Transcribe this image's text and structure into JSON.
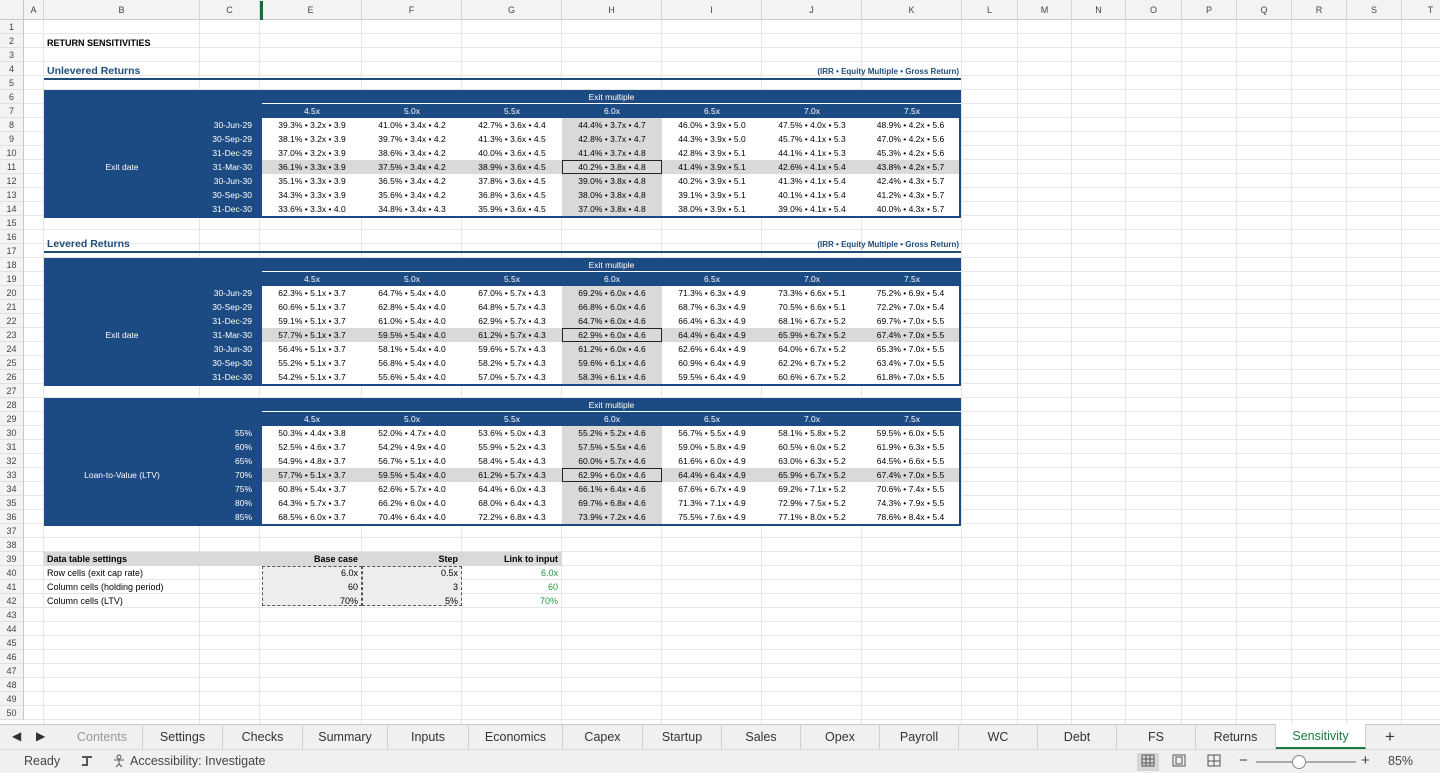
{
  "columns": [
    "A",
    "B",
    "C",
    "E",
    "F",
    "G",
    "H",
    "I",
    "J",
    "K",
    "L",
    "M",
    "N",
    "O",
    "P",
    "Q",
    "R",
    "S",
    "T"
  ],
  "sheet_title": "RETURN SENSITIVITIES",
  "unlevered": {
    "title": "Unlevered Returns",
    "note": "(IRR • Equity Multiple • Gross Return)",
    "header": "Exit multiple",
    "row_label": "Exit date",
    "col_labels": [
      "4.5x",
      "5.0x",
      "5.5x",
      "6.0x",
      "6.5x",
      "7.0x",
      "7.5x"
    ],
    "row_labels": [
      "30-Jun-29",
      "30-Sep-29",
      "31-Dec-29",
      "31-Mar-30",
      "30-Jun-30",
      "30-Sep-30",
      "31-Dec-30"
    ],
    "rows": [
      [
        "39.3% • 3.2x • 3.9",
        "41.0% • 3.4x • 4.2",
        "42.7% • 3.6x • 4.4",
        "44.4% • 3.7x • 4.7",
        "46.0% • 3.9x • 5.0",
        "47.5% • 4.0x • 5.3",
        "48.9% • 4.2x • 5.6"
      ],
      [
        "38.1% • 3.2x • 3.9",
        "39.7% • 3.4x • 4.2",
        "41.3% • 3.6x • 4.5",
        "42.8% • 3.7x • 4.7",
        "44.3% • 3.9x • 5.0",
        "45.7% • 4.1x • 5.3",
        "47.0% • 4.2x • 5.6"
      ],
      [
        "37.0% • 3.2x • 3.9",
        "38.6% • 3.4x • 4.2",
        "40.0% • 3.6x • 4.5",
        "41.4% • 3.7x • 4.8",
        "42.8% • 3.9x • 5.1",
        "44.1% • 4.1x • 5.3",
        "45.3% • 4.2x • 5.6"
      ],
      [
        "36.1% • 3.3x • 3.9",
        "37.5% • 3.4x • 4.2",
        "38.9% • 3.6x • 4.5",
        "40.2% • 3.8x • 4.8",
        "41.4% • 3.9x • 5.1",
        "42.6% • 4.1x • 5.4",
        "43.8% • 4.2x • 5.7"
      ],
      [
        "35.1% • 3.3x • 3.9",
        "36.5% • 3.4x • 4.2",
        "37.8% • 3.6x • 4.5",
        "39.0% • 3.8x • 4.8",
        "40.2% • 3.9x • 5.1",
        "41.3% • 4.1x • 5.4",
        "42.4% • 4.3x • 5.7"
      ],
      [
        "34.3% • 3.3x • 3.9",
        "35.6% • 3.4x • 4.2",
        "36.8% • 3.6x • 4.5",
        "38.0% • 3.8x • 4.8",
        "39.1% • 3.9x • 5.1",
        "40.1% • 4.1x • 5.4",
        "41.2% • 4.3x • 5.7"
      ],
      [
        "33.6% • 3.3x • 4.0",
        "34.8% • 3.4x • 4.3",
        "35.9% • 3.6x • 4.5",
        "37.0% • 3.8x • 4.8",
        "38.0% • 3.9x • 5.1",
        "39.0% • 4.1x • 5.4",
        "40.0% • 4.3x • 5.7"
      ]
    ]
  },
  "levered": {
    "title": "Levered Returns",
    "note": "(IRR • Equity Multiple • Gross Return)",
    "header": "Exit multiple",
    "row_label": "Exit date",
    "col_labels": [
      "4.5x",
      "5.0x",
      "5.5x",
      "6.0x",
      "6.5x",
      "7.0x",
      "7.5x"
    ],
    "row_labels": [
      "30-Jun-29",
      "30-Sep-29",
      "31-Dec-29",
      "31-Mar-30",
      "30-Jun-30",
      "30-Sep-30",
      "31-Dec-30"
    ],
    "rows": [
      [
        "62.3% • 5.1x • 3.7",
        "64.7% • 5.4x • 4.0",
        "67.0% • 5.7x • 4.3",
        "69.2% • 6.0x • 4.6",
        "71.3% • 6.3x • 4.9",
        "73.3% • 6.6x • 5.1",
        "75.2% • 6.9x • 5.4"
      ],
      [
        "60.6% • 5.1x • 3.7",
        "62.8% • 5.4x • 4.0",
        "64.8% • 5.7x • 4.3",
        "66.8% • 6.0x • 4.6",
        "68.7% • 6.3x • 4.9",
        "70.5% • 6.6x • 5.1",
        "72.2% • 7.0x • 5.4"
      ],
      [
        "59.1% • 5.1x • 3.7",
        "61.0% • 5.4x • 4.0",
        "62.9% • 5.7x • 4.3",
        "64.7% • 6.0x • 4.6",
        "66.4% • 6.3x • 4.9",
        "68.1% • 6.7x • 5.2",
        "69.7% • 7.0x • 5.5"
      ],
      [
        "57.7% • 5.1x • 3.7",
        "59.5% • 5.4x • 4.0",
        "61.2% • 5.7x • 4.3",
        "62.9% • 6.0x • 4.6",
        "64.4% • 6.4x • 4.9",
        "65.9% • 6.7x • 5.2",
        "67.4% • 7.0x • 5.5"
      ],
      [
        "56.4% • 5.1x • 3.7",
        "58.1% • 5.4x • 4.0",
        "59.6% • 5.7x • 4.3",
        "61.2% • 6.0x • 4.6",
        "62.6% • 6.4x • 4.9",
        "64.0% • 6.7x • 5.2",
        "65.3% • 7.0x • 5.5"
      ],
      [
        "55.2% • 5.1x • 3.7",
        "56.8% • 5.4x • 4.0",
        "58.2% • 5.7x • 4.3",
        "59.6% • 6.1x • 4.6",
        "60.9% • 6.4x • 4.9",
        "62.2% • 6.7x • 5.2",
        "63.4% • 7.0x • 5.5"
      ],
      [
        "54.2% • 5.1x • 3.7",
        "55.6% • 5.4x • 4.0",
        "57.0% • 5.7x • 4.3",
        "58.3% • 6.1x • 4.6",
        "59.5% • 6.4x • 4.9",
        "60.6% • 6.7x • 5.2",
        "61.8% • 7.0x • 5.5"
      ]
    ]
  },
  "ltv": {
    "header": "Exit multiple",
    "row_label": "Loan-to-Value (LTV)",
    "col_labels": [
      "4.5x",
      "5.0x",
      "5.5x",
      "6.0x",
      "6.5x",
      "7.0x",
      "7.5x"
    ],
    "row_labels": [
      "55%",
      "60%",
      "65%",
      "70%",
      "75%",
      "80%",
      "85%"
    ],
    "rows": [
      [
        "50.3% • 4.4x • 3.8",
        "52.0% • 4.7x • 4.0",
        "53.6% • 5.0x • 4.3",
        "55.2% • 5.2x • 4.6",
        "56.7% • 5.5x • 4.9",
        "58.1% • 5.8x • 5.2",
        "59.5% • 6.0x • 5.5"
      ],
      [
        "52.5% • 4.6x • 3.7",
        "54.2% • 4.9x • 4.0",
        "55.9% • 5.2x • 4.3",
        "57.5% • 5.5x • 4.6",
        "59.0% • 5.8x • 4.9",
        "60.5% • 6.0x • 5.2",
        "61.9% • 6.3x • 5.5"
      ],
      [
        "54.9% • 4.8x • 3.7",
        "56.7% • 5.1x • 4.0",
        "58.4% • 5.4x • 4.3",
        "60.0% • 5.7x • 4.6",
        "61.6% • 6.0x • 4.9",
        "63.0% • 6.3x • 5.2",
        "64.5% • 6.6x • 5.5"
      ],
      [
        "57.7% • 5.1x • 3.7",
        "59.5% • 5.4x • 4.0",
        "61.2% • 5.7x • 4.3",
        "62.9% • 6.0x • 4.6",
        "64.4% • 6.4x • 4.9",
        "65.9% • 6.7x • 5.2",
        "67.4% • 7.0x • 5.5"
      ],
      [
        "60.8% • 5.4x • 3.7",
        "62.6% • 5.7x • 4.0",
        "64.4% • 6.0x • 4.3",
        "66.1% • 6.4x • 4.6",
        "67.6% • 6.7x • 4.9",
        "69.2% • 7.1x • 5.2",
        "70.6% • 7.4x • 5.5"
      ],
      [
        "64.3% • 5.7x • 3.7",
        "66.2% • 6.0x • 4.0",
        "68.0% • 6.4x • 4.3",
        "69.7% • 6.8x • 4.6",
        "71.3% • 7.1x • 4.9",
        "72.9% • 7.5x • 5.2",
        "74.3% • 7.9x • 5.5"
      ],
      [
        "68.5% • 6.0x • 3.7",
        "70.4% • 6.4x • 4.0",
        "72.2% • 6.8x • 4.3",
        "73.9% • 7.2x • 4.6",
        "75.5% • 7.6x • 4.9",
        "77.1% • 8.0x • 5.2",
        "78.6% • 8.4x • 5.4"
      ]
    ]
  },
  "settings": {
    "title": "Data table settings",
    "col_base": "Base case",
    "col_step": "Step",
    "col_link": "Link to input",
    "rows": [
      {
        "label": "Row cells (exit cap rate)",
        "base": "6.0x",
        "step": "0.5x",
        "link": "6.0x"
      },
      {
        "label": "Column cells (holding period)",
        "base": "60",
        "step": "3",
        "link": "60"
      },
      {
        "label": "Column cells (LTV)",
        "base": "70%",
        "step": "5%",
        "link": "70%"
      }
    ]
  },
  "tabs": [
    "Contents",
    "Settings",
    "Checks",
    "Summary",
    "Inputs",
    "Economics",
    "Capex",
    "Startup",
    "Sales",
    "Opex",
    "Payroll",
    "WC",
    "Debt",
    "FS",
    "Returns",
    "Sensitivity"
  ],
  "active_tab": "Sensitivity",
  "add_tab_label": "+",
  "status": {
    "ready": "Ready",
    "accessibility": "Accessibility: Investigate",
    "zoom": "85%",
    "zoom_minus": "−",
    "zoom_plus": "+",
    "zoom_level": 0.85
  }
}
